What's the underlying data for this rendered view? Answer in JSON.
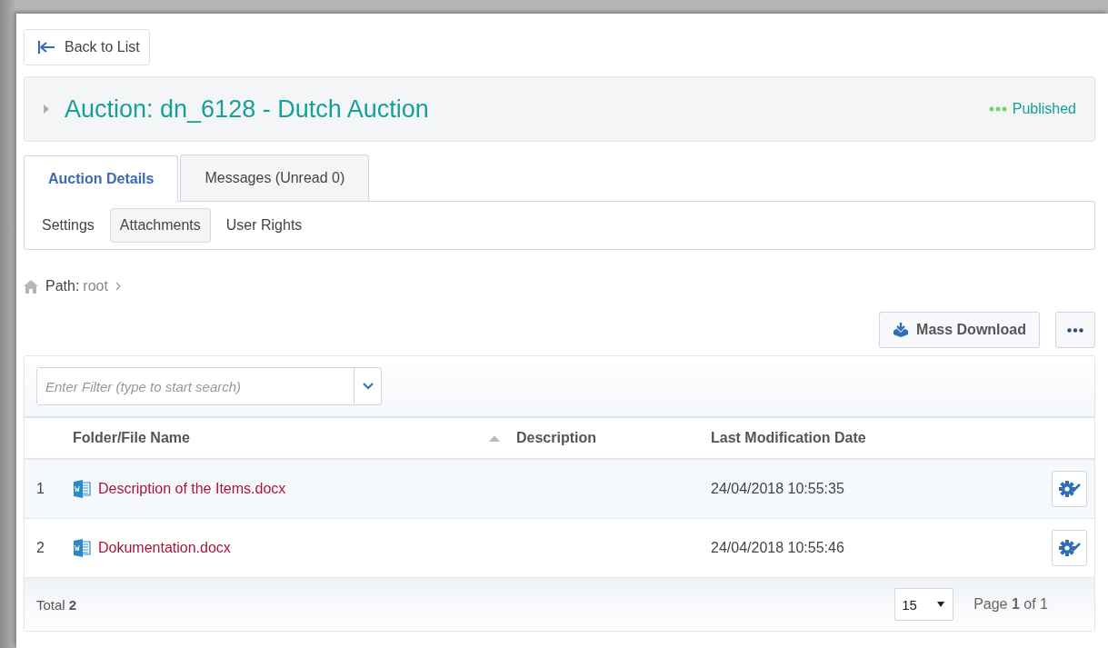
{
  "back_button": {
    "label": "Back to List"
  },
  "header": {
    "title": "Auction: dn_6128 - Dutch Auction",
    "status": {
      "label": "Published",
      "color": "#7ccf6a"
    }
  },
  "tabs": [
    {
      "label": "Auction Details",
      "selected": true
    },
    {
      "label": "Messages (Unread 0)",
      "selected": false
    }
  ],
  "subtabs": [
    {
      "label": "Settings",
      "selected": false
    },
    {
      "label": "Attachments",
      "selected": true
    },
    {
      "label": "User Rights",
      "selected": false
    }
  ],
  "path": {
    "label": "Path:",
    "items": [
      "root"
    ]
  },
  "toolbar": {
    "mass_download": "Mass Download"
  },
  "filter": {
    "placeholder": "Enter Filter (type to start search)"
  },
  "table": {
    "columns": [
      {
        "label": "Folder/File Name",
        "sorted": true
      },
      {
        "label": "Description",
        "sorted": false
      },
      {
        "label": "Last Modification Date",
        "sorted": false
      }
    ],
    "rows": [
      {
        "index": "1",
        "name": "Description of the Items.docx",
        "date": "24/04/2018 10:55:35"
      },
      {
        "index": "2",
        "name": "Dokumentation.docx",
        "date": "24/04/2018 10:55:46"
      }
    ]
  },
  "footer": {
    "total": "Total **2**",
    "page_size": "15",
    "page": "Page **1** of 1"
  }
}
